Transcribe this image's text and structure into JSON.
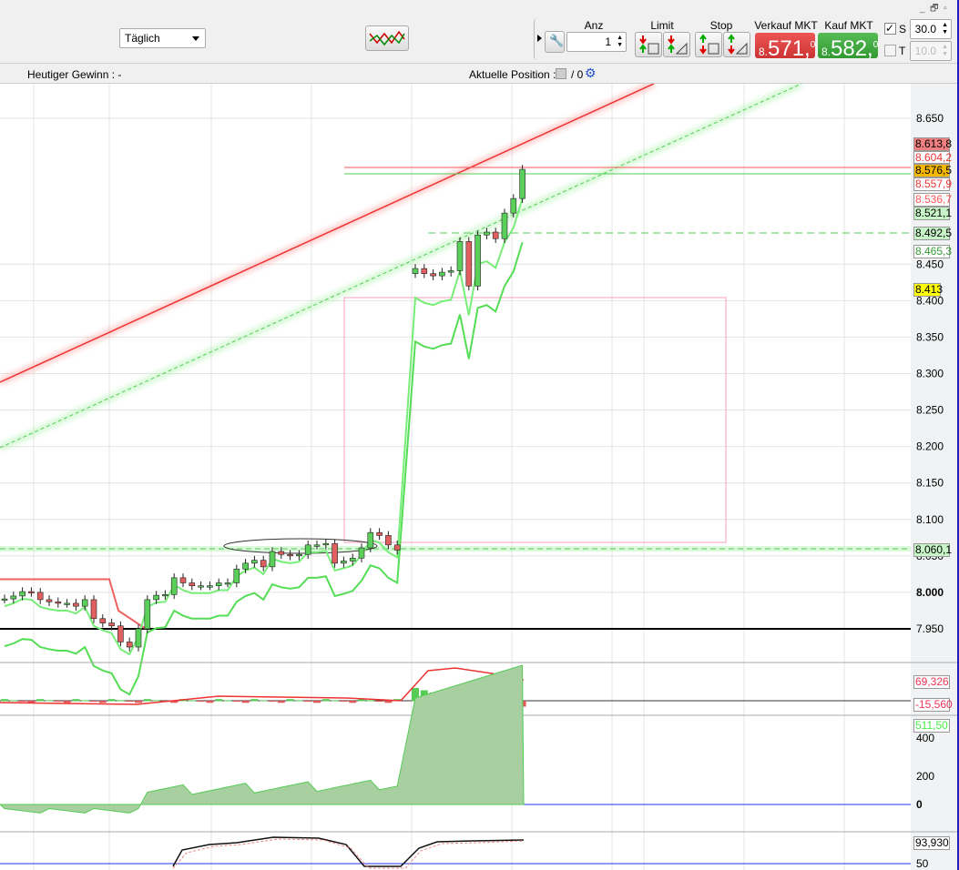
{
  "toolbar": {
    "period": "Täglich",
    "anz_label": "Anz",
    "anz_value": "1",
    "limit_label": "Limit",
    "stop_label": "Stop",
    "sell_label": "Verkauf MKT",
    "sell_prefix": "8.",
    "sell_main": "571,",
    "sell_sup": "0",
    "buy_label": "Kauf MKT",
    "buy_prefix": "8.",
    "buy_main": "582,",
    "buy_sup": "0",
    "s_label": "S",
    "s_value": "30.0",
    "s_checked": true,
    "t_label": "T",
    "t_value": "10.0",
    "t_checked": false
  },
  "info": {
    "gewinn": "Heutiger Gewinn : -",
    "position_label": "Aktuelle Position : 0",
    "position_sep": "/ 0"
  },
  "colors": {
    "sell": "#d83a3a",
    "buy": "#3fa33f",
    "up": "#5ad05a",
    "down": "#e06060"
  },
  "price_axis": [
    "8.650",
    "8.450",
    "8.400",
    "8.350",
    "8.300",
    "8.250",
    "8.200",
    "8.150",
    "8.100",
    "8.050",
    "8.000",
    "7.950"
  ],
  "price_tags": {
    "t1": "8.613,8",
    "t1b": "8.604,2",
    "t2": "8.576,5",
    "t3": "8.557,9",
    "t4": "8.536,7",
    "t5": "8.521,1",
    "t6": "8.492,5",
    "t7": "8.465,3",
    "t8": "8.413",
    "t9": "8.060,1"
  },
  "macd": {
    "v1": "69,326",
    "v2": "-15,560"
  },
  "panel2": {
    "tag": "511,50",
    "ticks": [
      "400",
      "200",
      "0"
    ]
  },
  "panel3": {
    "tag": "93,930",
    "ticks": [
      "50"
    ]
  },
  "chart_data": {
    "type": "candlestick",
    "closes": [
      7.991,
      7.995,
      8.001,
      8.0,
      7.99,
      7.987,
      7.985,
      7.985,
      7.981,
      7.99,
      7.964,
      7.958,
      7.954,
      7.932,
      7.925,
      7.95,
      7.99,
      7.996,
      7.997,
      8.02,
      8.013,
      8.009,
      8.009,
      8.009,
      8.013,
      8.013,
      8.032,
      8.04,
      8.044,
      8.035,
      8.056,
      8.052,
      8.05,
      8.052,
      8.065,
      8.065,
      8.067,
      8.04,
      8.043,
      8.047,
      8.061,
      8.082,
      8.078,
      8.065,
      8.058,
      8.444,
      8.437,
      8.434,
      8.439,
      8.441,
      8.481,
      8.42,
      8.49,
      8.494,
      8.485,
      8.52,
      8.54,
      8.58
    ]
  }
}
